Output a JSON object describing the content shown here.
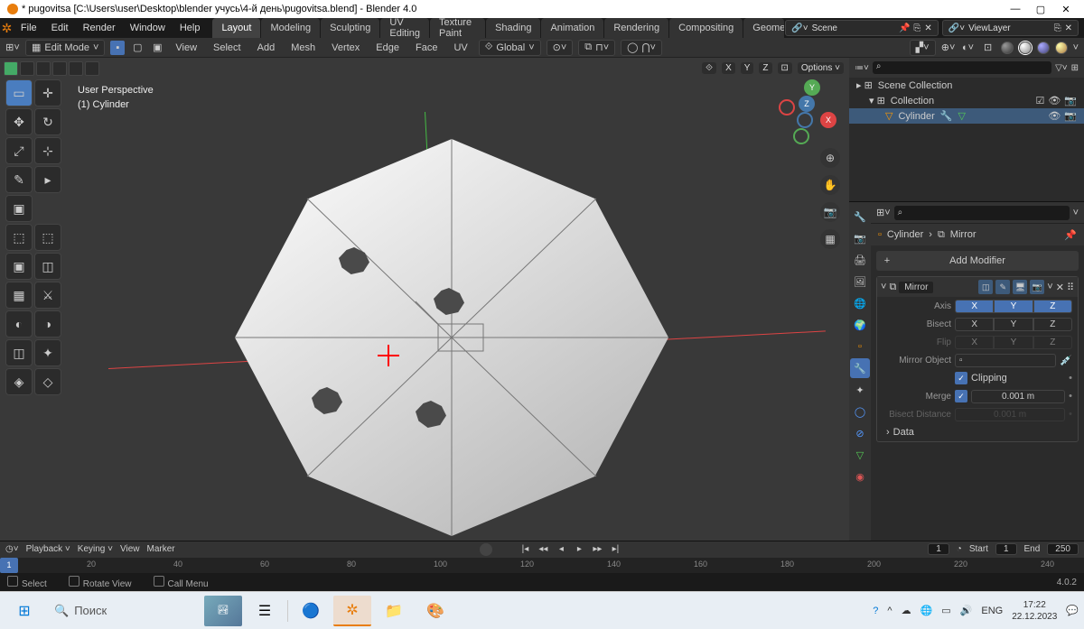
{
  "window": {
    "title": "* pugovitsa [C:\\Users\\user\\Desktop\\blender учусь\\4-й день\\pugovitsa.blend] - Blender 4.0"
  },
  "menu": {
    "file": "File",
    "edit": "Edit",
    "render": "Render",
    "window": "Window",
    "help": "Help"
  },
  "workspaces": {
    "layout": "Layout",
    "modeling": "Modeling",
    "sculpting": "Sculpting",
    "uv": "UV Editing",
    "texture": "Texture Paint",
    "shading": "Shading",
    "animation": "Animation",
    "rendering": "Rendering",
    "compositing": "Compositing",
    "geometry": "Geomet"
  },
  "scene": {
    "label": "Scene",
    "viewlayer": "ViewLayer"
  },
  "header3d": {
    "mode": "Edit Mode",
    "view": "View",
    "select": "Select",
    "add": "Add",
    "mesh": "Mesh",
    "vertex": "Vertex",
    "edge": "Edge",
    "face": "Face",
    "uv": "UV",
    "global": "Global",
    "options": "Options",
    "axes": {
      "x": "X",
      "y": "Y",
      "z": "Z"
    }
  },
  "hud": {
    "persp": "User Perspective",
    "obj": "(1) Cylinder"
  },
  "gizmo": {
    "x": "X",
    "y": "Y",
    "z": "Z"
  },
  "outliner": {
    "scene_collection": "Scene Collection",
    "collection": "Collection",
    "cylinder": "Cylinder"
  },
  "props": {
    "breadcrumb_obj": "Cylinder",
    "breadcrumb_mod": "Mirror",
    "add_modifier": "Add Modifier",
    "mirror": {
      "name": "Mirror",
      "axis": "Axis",
      "bisect": "Bisect",
      "flip": "Flip",
      "mirror_object": "Mirror Object",
      "clipping": "Clipping",
      "merge": "Merge",
      "merge_val": "0.001 m",
      "bisect_distance": "Bisect Distance",
      "bisect_val": "0.001 m",
      "data": "Data",
      "x": "X",
      "y": "Y",
      "z": "Z"
    },
    "search_icon": "⌕"
  },
  "timeline": {
    "playback": "Playback",
    "keying": "Keying",
    "view": "View",
    "marker": "Marker",
    "frame": "1",
    "start": "Start",
    "start_val": "1",
    "end": "End",
    "end_val": "250",
    "ticks": [
      "20",
      "40",
      "60",
      "80",
      "100",
      "120",
      "140",
      "160",
      "180",
      "200",
      "220",
      "240"
    ]
  },
  "status": {
    "select": "Select",
    "rotate": "Rotate View",
    "menu": "Call Menu",
    "version": "4.0.2"
  },
  "taskbar": {
    "search": "Поиск",
    "lang": "ENG",
    "time": "17:22",
    "date": "22.12.2023"
  },
  "chart_data": null
}
